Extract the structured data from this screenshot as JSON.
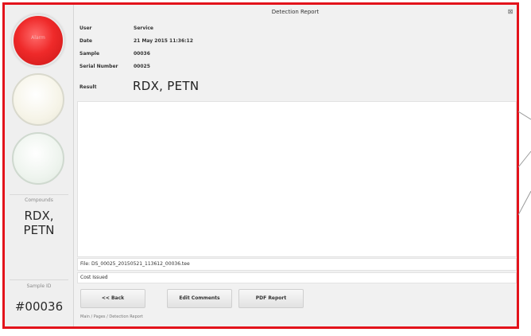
{
  "window": {
    "title": "Detection Report",
    "close_glyph": "⊠"
  },
  "lights": {
    "red_caption": "Alarm",
    "compound_caption": "Compounds",
    "compound_name": "RDX,\nPETN",
    "sample_caption": "Sample ID",
    "sample_id": "#00036"
  },
  "details": [
    {
      "key": "User",
      "value": "Service"
    },
    {
      "key": "Date",
      "value": "21 May 2015 11:36:12"
    },
    {
      "key": "Sample",
      "value": "00036"
    },
    {
      "key": "Serial Number",
      "value": "00025"
    }
  ],
  "result": {
    "key": "Result",
    "value": "RDX, PETN"
  },
  "comments": {
    "text": ""
  },
  "file": "File: DS_00025_20150521_113612_00036.tee",
  "cost": "Cost Issued",
  "buttons": {
    "back": "<< Back",
    "edit_comments": "Edit Comments",
    "pdf_report": "PDF Report"
  },
  "breadcrumb": "Main / Pages / Detection Report"
}
